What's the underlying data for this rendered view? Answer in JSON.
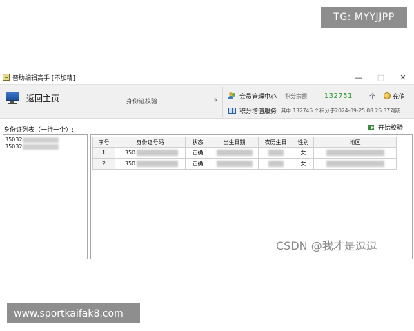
{
  "watermarks": {
    "tg_badge": "TG: MYYJJPP",
    "site_badge": "www.sportkaifak8.com",
    "csdn": "CSDN @我才是逗逗"
  },
  "window": {
    "title": "普助编辑高手 [不加精]",
    "controls": {
      "minimize": "—",
      "maximize": "□",
      "close": "✕"
    }
  },
  "toolbar": {
    "home_label": "返回主页",
    "section_label": "身份证校验",
    "expand_glyph": "»",
    "member_center": "会员管理中心",
    "points_label": "积分余额:",
    "points_value": "132751",
    "points_unit": "个",
    "recharge": "充值",
    "value_added": "积分增值服务",
    "points_note": "其中 132746 个积分于2024-09-25 08:26:37到期"
  },
  "id_list": {
    "label": "身份证列表（一行一个）:",
    "start_button": "开始校验",
    "lines": [
      "35032",
      "35032"
    ]
  },
  "results": {
    "columns": [
      "序号",
      "身份证号码",
      "状态",
      "出生日期",
      "农历生日",
      "性别",
      "地区"
    ],
    "rows": [
      {
        "seq": "1",
        "id_prefix": "350",
        "status": "正确",
        "gender": "女"
      },
      {
        "seq": "2",
        "id_prefix": "350",
        "status": "正确",
        "gender": "女"
      }
    ]
  },
  "colors": {
    "points_value": "#2f9a2f",
    "toolbar_bg": "#f0f0f0",
    "badge_bg": "#8e8e8e"
  },
  "icons": [
    "app-icon",
    "monitor-icon",
    "users-icon",
    "book-icon",
    "coin-icon",
    "start-check-icon"
  ]
}
